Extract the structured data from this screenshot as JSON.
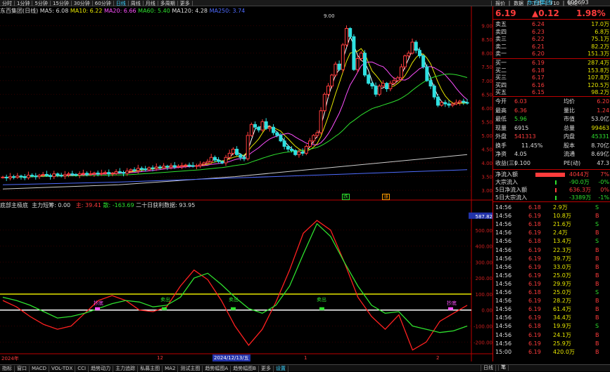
{
  "top_menu": [
    "分时",
    "1分钟",
    "5分钟",
    "15分钟",
    "30分钟",
    "60分钟",
    "日线",
    "周线",
    "月线",
    "多周期",
    "更多"
  ],
  "top_right_menu": [
    "报价",
    "数据",
    "工具",
    "F10",
    "论论"
  ],
  "stock": {
    "name": "东百集团",
    "code": "600693",
    "price": "6.19",
    "change": "▲0.12",
    "change_pct": "1.98%"
  },
  "ma_legend": {
    "title": "东百集团(日线)",
    "ma5": "MA5: 6.08",
    "ma10": "MA10: 6.22",
    "ma20": "MA20: 6.66",
    "ma60": "MA60: 5.40",
    "ma120": "MA120: 4.28",
    "ma250": "MA250: 3.74"
  },
  "price_axis": [
    "9.00",
    "8.50",
    "8.00",
    "7.50",
    "7.00",
    "6.50",
    "6.00",
    "5.50",
    "5.00",
    "4.50",
    "4.00",
    "3.50",
    "3.00"
  ],
  "peak_label": "9.00",
  "signal_labels": {
    "s1": "跌",
    "s2": "涨"
  },
  "indicator_legend": {
    "name": "底部主极底",
    "main": "主力短筹: 0.00",
    "zhu": "主: 39.41",
    "san": "散: -163.69",
    "twenty": "二十日获利数据: 93.95"
  },
  "ind_axis": [
    "587.82",
    "500.00",
    "400.00",
    "300.00",
    "200.00",
    "100.00",
    "0.00",
    "-100.00",
    "-200.00"
  ],
  "ind_labels": [
    "抄底",
    "卖出",
    "卖出",
    "卖出",
    "抄底"
  ],
  "date_axis": {
    "left": "2024年",
    "mid1": "12",
    "highlight": "2024/12/13/五",
    "mid2": "1",
    "right": "2"
  },
  "order_book": {
    "asks": [
      {
        "label": "卖五",
        "price": "6.24",
        "vol": "17.0万"
      },
      {
        "label": "卖四",
        "price": "6.23",
        "vol": "6.8万"
      },
      {
        "label": "卖三",
        "price": "6.22",
        "vol": "75.1万"
      },
      {
        "label": "卖二",
        "price": "6.21",
        "vol": "82.2万"
      },
      {
        "label": "卖一",
        "price": "6.20",
        "vol": "151.3万"
      }
    ],
    "bids": [
      {
        "label": "买一",
        "price": "6.19",
        "vol": "287.4万"
      },
      {
        "label": "买二",
        "price": "6.18",
        "vol": "153.8万"
      },
      {
        "label": "买三",
        "price": "6.17",
        "vol": "107.8万"
      },
      {
        "label": "买四",
        "price": "6.16",
        "vol": "120.5万"
      },
      {
        "label": "买五",
        "price": "6.15",
        "vol": "98.2万"
      }
    ]
  },
  "stats": [
    {
      "l1": "今开",
      "v1": "6.03",
      "l2": "均价",
      "v2": "6.20"
    },
    {
      "l1": "最高",
      "v1": "6.36",
      "l2": "量比",
      "v2": "1.24"
    },
    {
      "l1": "最低",
      "v1": "5.96",
      "l2": "市值",
      "v2": "53.0亿"
    },
    {
      "l1": "现量",
      "v1": "6915",
      "l2": "总量",
      "v2": "99463"
    },
    {
      "l1": "外盘",
      "v1": "541313",
      "l2": "内盘",
      "v2": "45331"
    },
    {
      "l1": "换手",
      "v1": "11.45%",
      "l2": "股本",
      "v2": "8.70亿"
    },
    {
      "l1": "净资",
      "v1": "4.05",
      "l2": "流通",
      "v2": "8.69亿"
    },
    {
      "l1": "收益(三)",
      "v1": "0.100",
      "l2": "PE(动)",
      "v2": "47.3"
    }
  ],
  "flow": [
    {
      "label": "净流入额",
      "value": "4044万",
      "pct": "7%"
    },
    {
      "label": "大宗流入",
      "value": "-90.0万",
      "pct": "-0%"
    },
    {
      "label": "5日净流入额",
      "value": "636.3万",
      "pct": "0%"
    },
    {
      "label": "5日大宗流入",
      "value": "-3389万",
      "pct": "-1%"
    }
  ],
  "ticks": [
    {
      "t": "14:56",
      "p": "6.18",
      "v": "2.9万",
      "d": "S"
    },
    {
      "t": "14:56",
      "p": "6.19",
      "v": "10.8万",
      "d": "B"
    },
    {
      "t": "14:56",
      "p": "6.18",
      "v": "21.6万",
      "d": "S"
    },
    {
      "t": "14:56",
      "p": "6.19",
      "v": "2.4万",
      "d": "B"
    },
    {
      "t": "14:56",
      "p": "6.18",
      "v": "13.4万",
      "d": "S"
    },
    {
      "t": "14:56",
      "p": "6.19",
      "v": "22.3万",
      "d": "B"
    },
    {
      "t": "14:56",
      "p": "6.19",
      "v": "39.7万",
      "d": "B"
    },
    {
      "t": "14:56",
      "p": "6.19",
      "v": "33.0万",
      "d": "B"
    },
    {
      "t": "14:56",
      "p": "6.19",
      "v": "25.0万",
      "d": "B"
    },
    {
      "t": "14:56",
      "p": "6.19",
      "v": "29.9万",
      "d": "B"
    },
    {
      "t": "14:56",
      "p": "6.18",
      "v": "25.0万",
      "d": "S"
    },
    {
      "t": "14:56",
      "p": "6.19",
      "v": "28.2万",
      "d": "B"
    },
    {
      "t": "14:56",
      "p": "6.19",
      "v": "61.4万",
      "d": "B"
    },
    {
      "t": "14:56",
      "p": "6.19",
      "v": "34.4万",
      "d": "B"
    },
    {
      "t": "14:56",
      "p": "6.18",
      "v": "19.9万",
      "d": "S"
    },
    {
      "t": "14:56",
      "p": "6.19",
      "v": "24.1万",
      "d": "B"
    },
    {
      "t": "14:56",
      "p": "6.19",
      "v": "25.9万",
      "d": "B"
    },
    {
      "t": "15:00",
      "p": "6.19",
      "v": "420.0万",
      "d": "B"
    }
  ],
  "bottom_tabs": [
    "指标",
    "窗口",
    "MACD",
    "VOL-TDX",
    "CCI",
    "趋势动力",
    "主力追踪",
    "私募主图",
    "MA2",
    "测试主图",
    "趋势幅图A",
    "趋势幅图B",
    "更多",
    "设置"
  ],
  "bottom_right": [
    "日线",
    "笔"
  ],
  "colors": {
    "up": "#ff3c3c",
    "down": "#2ee0e0",
    "ma5": "#ffffff",
    "ma10": "#e6e600",
    "ma20": "#ff50ff",
    "ma60": "#2ee02e",
    "ma120": "#cccccc",
    "ma250": "#4f6cff"
  }
}
